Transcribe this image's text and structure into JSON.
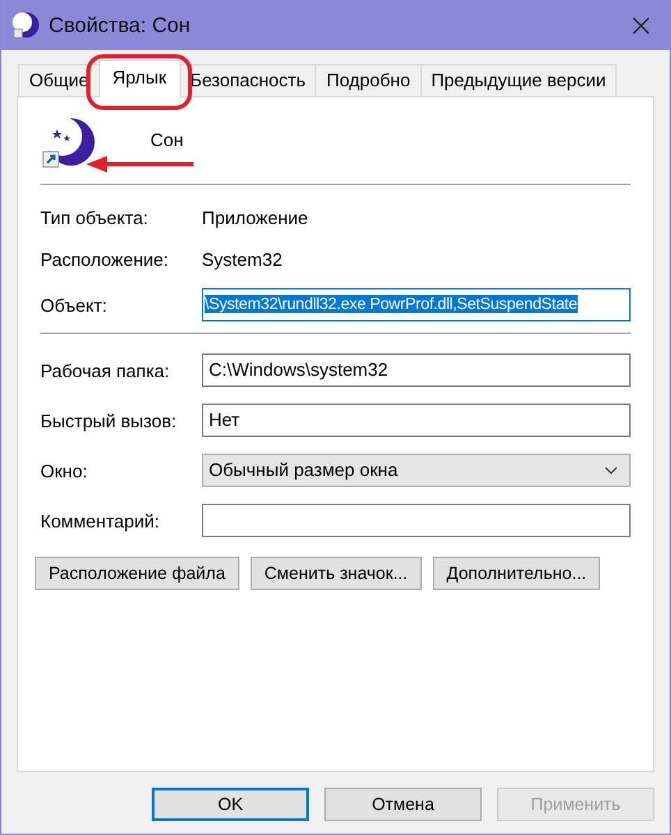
{
  "window": {
    "title": "Свойства: Сон"
  },
  "tabs": [
    {
      "label": "Общие",
      "selected": false
    },
    {
      "label": "Ярлык",
      "selected": true
    },
    {
      "label": "Безопасность",
      "selected": false
    },
    {
      "label": "Подробно",
      "selected": false
    },
    {
      "label": "Предыдущие версии",
      "selected": false
    }
  ],
  "shortcut": {
    "name": "Сон"
  },
  "info_rows": [
    {
      "label": "Тип объекта:",
      "value": "Приложение"
    },
    {
      "label": "Расположение:",
      "value": "System32"
    }
  ],
  "object_field": {
    "label": "Объект:",
    "value": "\\System32\\rundll32.exe PowrProf.dll,SetSuspendState",
    "selected": true
  },
  "fields": [
    {
      "kind": "input",
      "label": "Рабочая папка:",
      "value": "C:\\Windows\\system32"
    },
    {
      "kind": "input",
      "label": "Быстрый вызов:",
      "value": "Нет"
    },
    {
      "kind": "select",
      "label": "Окно:",
      "value": "Обычный размер окна"
    },
    {
      "kind": "input",
      "label": "Комментарий:"
    }
  ],
  "actions": [
    "Расположение файла",
    "Сменить значок...",
    "Дополнительно..."
  ],
  "buttons": [
    {
      "label": "OK",
      "default": true,
      "disabled": false
    },
    {
      "label": "Отмена",
      "default": false,
      "disabled": false
    },
    {
      "label": "Применить",
      "default": false,
      "disabled": true
    }
  ],
  "annotations": {
    "tab_ring": true,
    "icon_arrow": true
  }
}
